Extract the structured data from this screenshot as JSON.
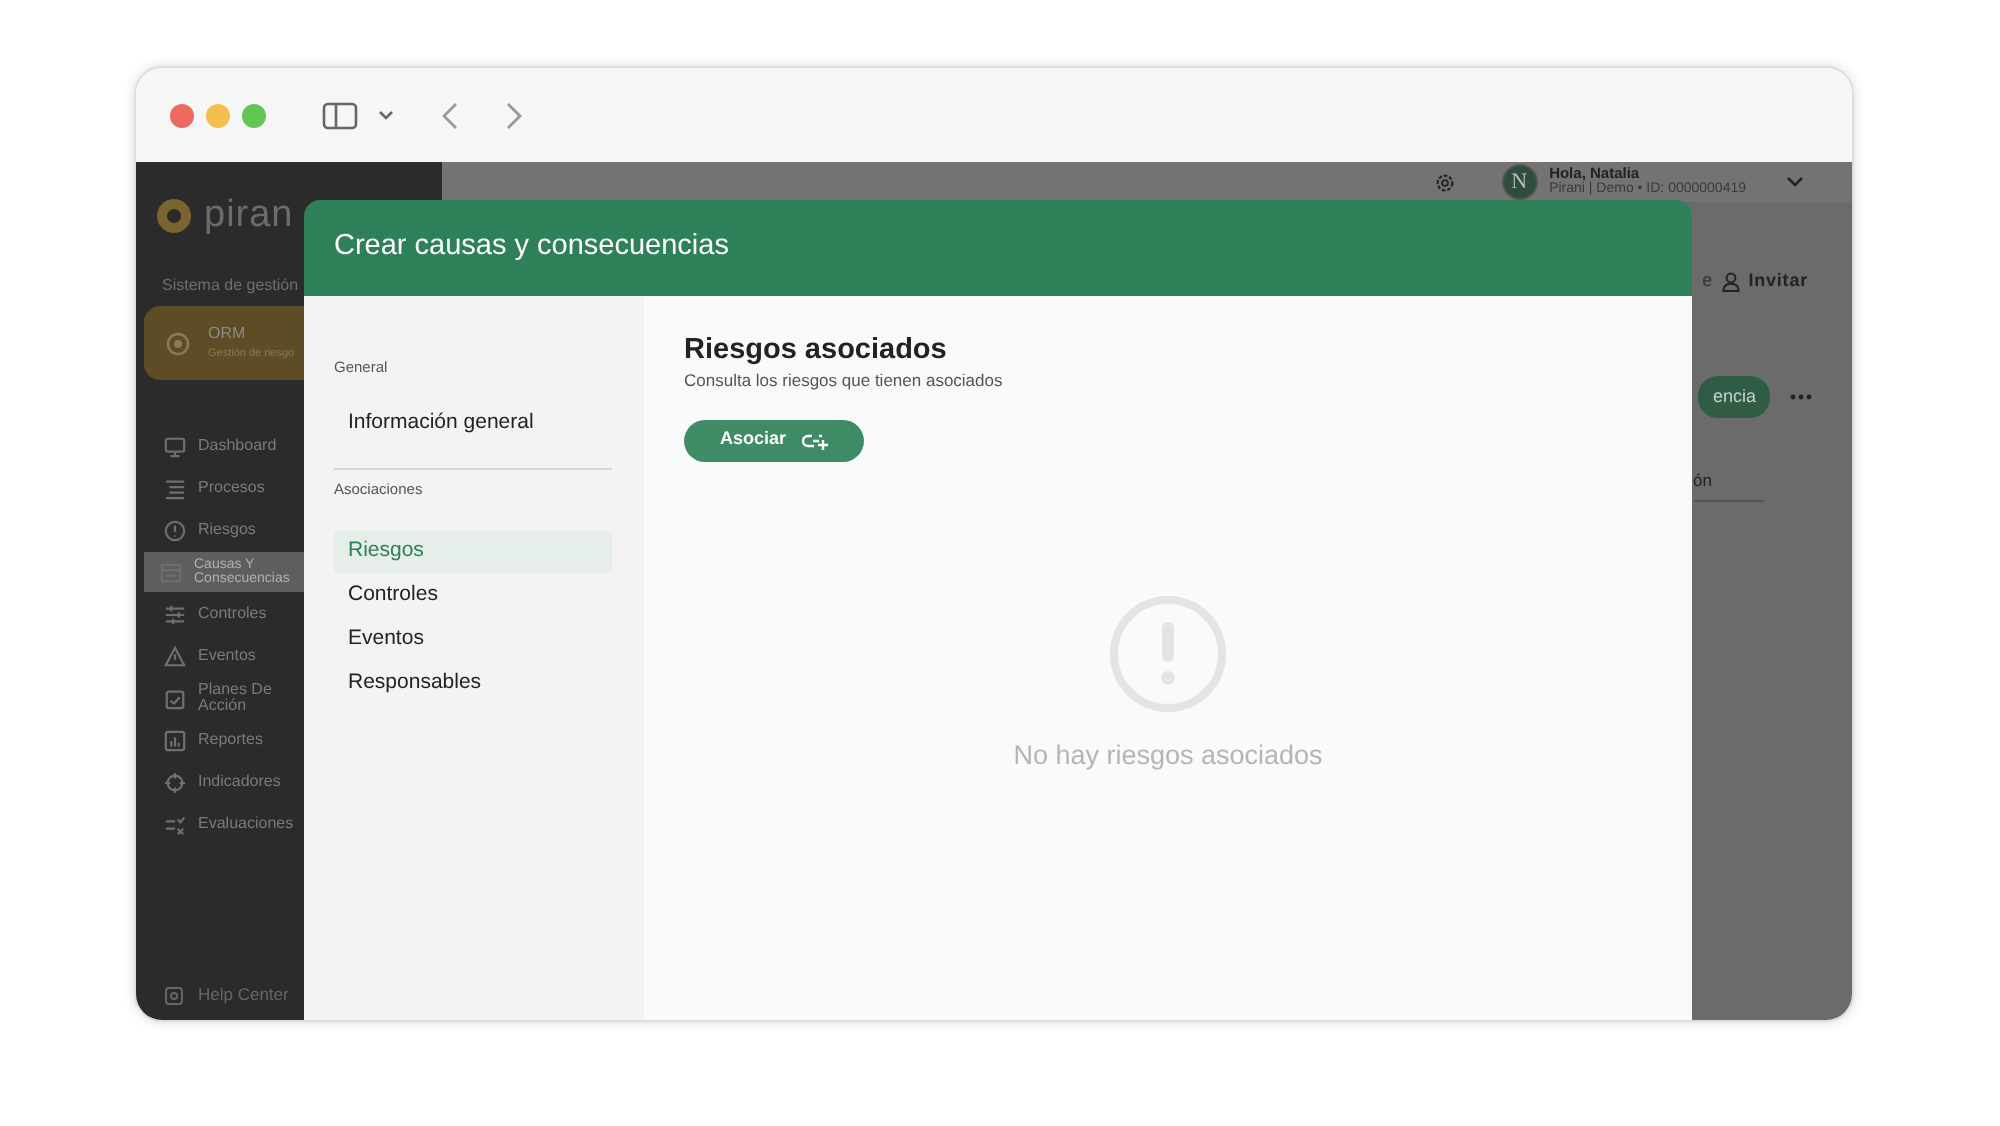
{
  "app": {
    "logo": "piran",
    "system_label": "Sistema de gestión",
    "module": {
      "title": "ORM",
      "subtitle": "Gestión de riesgo"
    },
    "nav": [
      {
        "label": "Dashboard",
        "selected": false
      },
      {
        "label": "Procesos",
        "selected": false
      },
      {
        "label": "Riesgos",
        "selected": false
      },
      {
        "label": "Causas Y Consecuencias",
        "selected": true
      },
      {
        "label": "Controles",
        "selected": false
      },
      {
        "label": "Eventos",
        "selected": false
      },
      {
        "label": "Planes De Acción",
        "selected": false
      },
      {
        "label": "Reportes",
        "selected": false
      },
      {
        "label": "Indicadores",
        "selected": false
      },
      {
        "label": "Evaluaciones",
        "selected": false
      }
    ],
    "help": "Help Center",
    "topbar": {
      "avatar": "N",
      "greeting": "Hola, Natalia",
      "account": "Pirani | Demo • ID: 0000000419"
    },
    "toolbar": {
      "cut_text": "e",
      "invite": "Invitar",
      "primary_button": "encia"
    },
    "column_header": "ón"
  },
  "modal": {
    "title": "Crear causas y consecuencias",
    "sections": [
      {
        "heading": "General",
        "items": [
          {
            "label": "Información general",
            "selected": false
          }
        ]
      },
      {
        "heading": "Asociaciones",
        "items": [
          {
            "label": "Riesgos",
            "selected": true
          },
          {
            "label": "Controles",
            "selected": false
          },
          {
            "label": "Eventos",
            "selected": false
          },
          {
            "label": "Responsables",
            "selected": false
          }
        ]
      }
    ],
    "content": {
      "title": "Riesgos asociados",
      "subtitle": "Consulta los riesgos que tienen asociados",
      "button": "Asociar",
      "empty": "No hay riesgos asociados"
    }
  }
}
